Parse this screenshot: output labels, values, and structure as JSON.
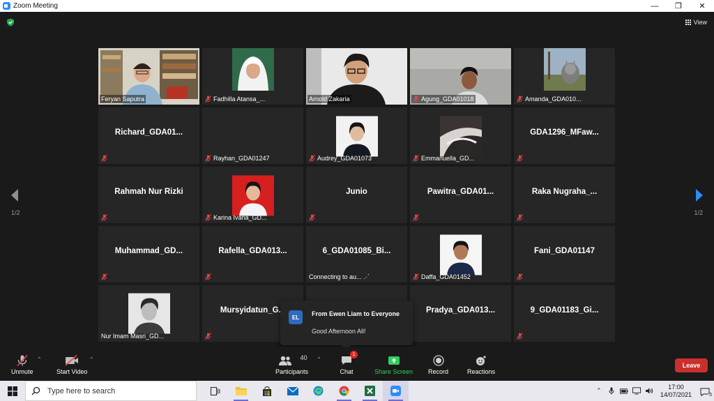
{
  "window": {
    "title": "Zoom Meeting"
  },
  "top_bar": {
    "view_label": "View"
  },
  "pagination": {
    "left": "1/2",
    "right": "1/2"
  },
  "tiles": [
    {
      "name": "Feryan Saputra",
      "muted": false,
      "kind": "video",
      "active": true
    },
    {
      "name": "Fadhilla Atansa_...",
      "muted": true,
      "kind": "photo"
    },
    {
      "name": "Arnold Zakaria",
      "muted": false,
      "kind": "video"
    },
    {
      "name": "Agung_GDA01018",
      "muted": true,
      "kind": "video"
    },
    {
      "name": "Amanda_GDA010...",
      "muted": true,
      "kind": "photo"
    },
    {
      "name": "Richard_GDA01...",
      "muted": true,
      "kind": "name"
    },
    {
      "name": "Rayhan_GDA01247",
      "muted": true,
      "kind": "label"
    },
    {
      "name": "Audrey_GDA01073",
      "muted": true,
      "kind": "photo"
    },
    {
      "name": "Emmanuella_GD...",
      "muted": true,
      "kind": "photo"
    },
    {
      "name": "GDA1296_MFaw...",
      "muted": true,
      "kind": "name"
    },
    {
      "name": "Rahmah Nur Rizki",
      "muted": true,
      "kind": "name"
    },
    {
      "name": "Karina Ivana_GD...",
      "muted": true,
      "kind": "photo"
    },
    {
      "name": "Junio",
      "muted": true,
      "kind": "name"
    },
    {
      "name": "Pawitra_GDA01...",
      "muted": true,
      "kind": "name"
    },
    {
      "name": "Raka  Nugraha_...",
      "muted": true,
      "kind": "name"
    },
    {
      "name": "Muhammad_GD...",
      "muted": true,
      "kind": "name"
    },
    {
      "name": "Rafella_GDA013...",
      "muted": true,
      "kind": "name"
    },
    {
      "name": "6_GDA01085_Bi...",
      "muted": false,
      "kind": "name",
      "status": "Connecting to au...",
      "status_suffix": ".·`"
    },
    {
      "name": "Daffa_GDA01452",
      "muted": true,
      "kind": "photo"
    },
    {
      "name": "Fani_GDA01147",
      "muted": true,
      "kind": "name"
    },
    {
      "name": "Nur Imam Masri_GD...",
      "muted": false,
      "kind": "photo"
    },
    {
      "name": "Mursyidatun_G...",
      "muted": true,
      "kind": "name"
    },
    {
      "name": "",
      "muted": false,
      "kind": "hidden"
    },
    {
      "name": "Pradya_GDA013...",
      "muted": false,
      "kind": "name"
    },
    {
      "name": "9_GDA01183_Gi...",
      "muted": true,
      "kind": "name"
    }
  ],
  "chat_popup": {
    "avatar_initials": "EL",
    "from": "From Ewen Liam to Everyone",
    "message": "Good Afternoon All!"
  },
  "controls": {
    "unmute": "Unmute",
    "start_video": "Start Video",
    "participants": "Participants",
    "participants_count": "40",
    "chat": "Chat",
    "chat_badge": "1",
    "share_screen": "Share Screen",
    "record": "Record",
    "reactions": "Reactions",
    "leave": "Leave"
  },
  "taskbar": {
    "search_placeholder": "Type here to search",
    "time": "17:00",
    "date": "14/07/2021",
    "notification_count": "5"
  },
  "colors": {
    "active_speaker": "#d6e84a",
    "leave": "#c9302c",
    "share": "#2fd05a",
    "muted_icon": "#e5484d",
    "zoom_blue": "#2d8cff"
  }
}
